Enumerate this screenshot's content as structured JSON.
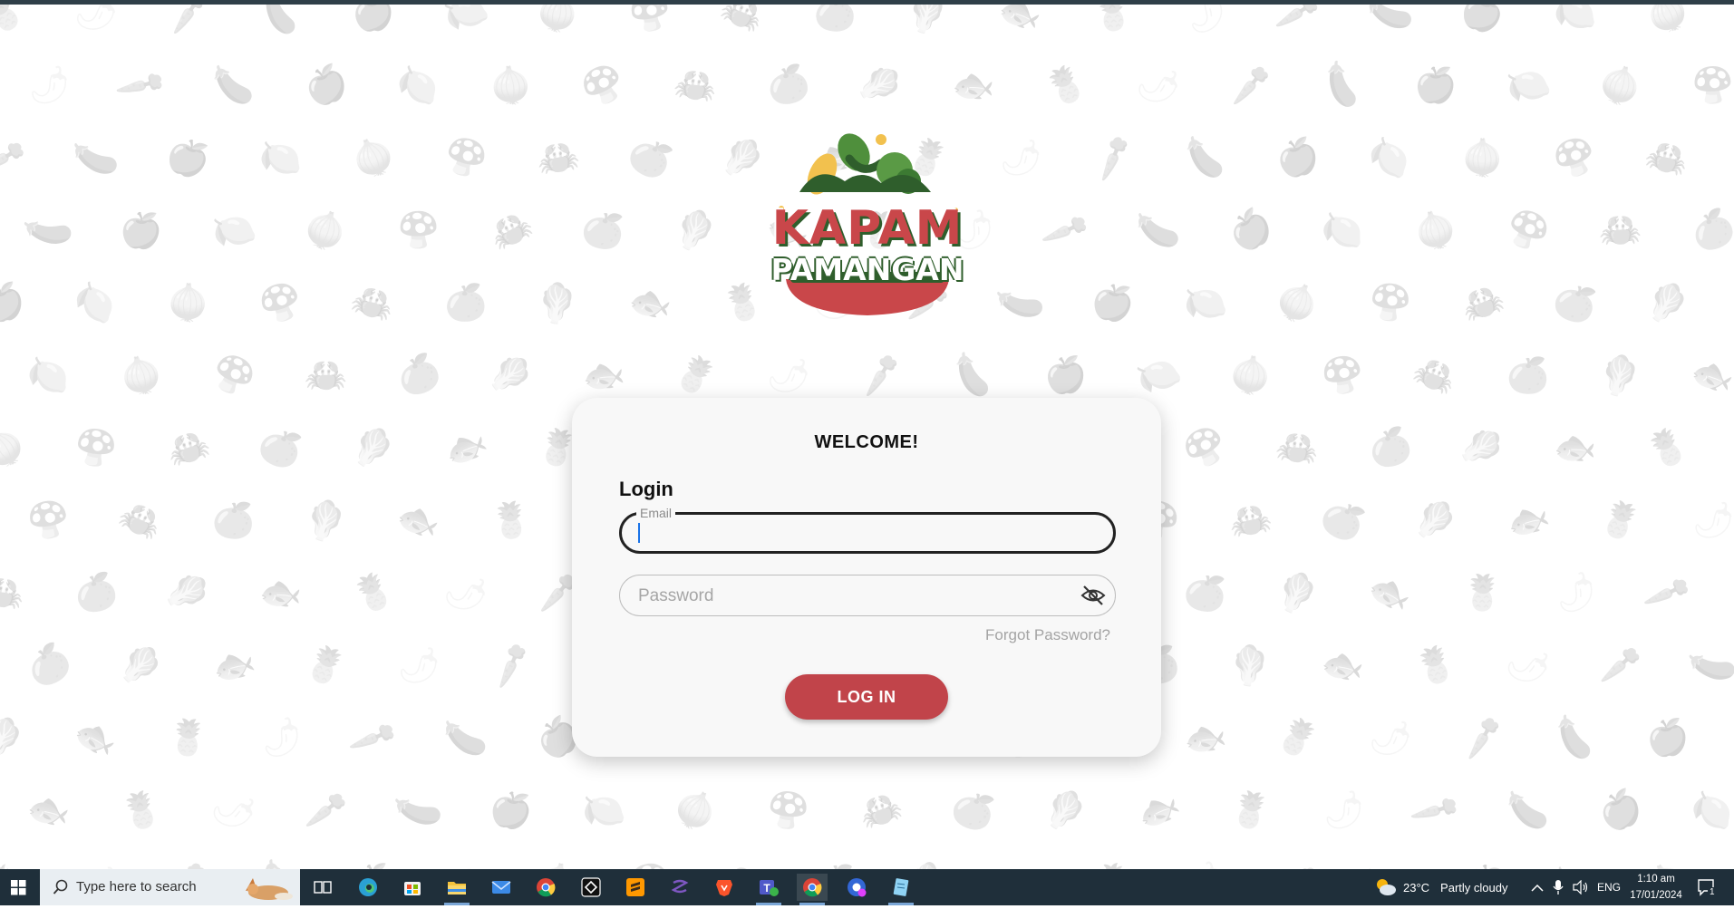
{
  "app": {
    "logo_line1": "KAPAM",
    "logo_line2": "PAMANGAN",
    "accent_color": "#c1444a",
    "logo_green": "#2f5e2c"
  },
  "login_card": {
    "heading": "WELCOME!",
    "section_title": "Login",
    "email": {
      "label": "Email",
      "value": ""
    },
    "password": {
      "placeholder": "Password",
      "value": "",
      "toggle_icon": "eye-slash-icon"
    },
    "forgot_link": "Forgot Password?",
    "submit_label": "LOG IN"
  },
  "taskbar": {
    "search_placeholder": "Type here to search",
    "apps": [
      {
        "name": "task-view-icon"
      },
      {
        "name": "edge-icon"
      },
      {
        "name": "microsoft-store-icon"
      },
      {
        "name": "file-explorer-icon"
      },
      {
        "name": "mail-icon"
      },
      {
        "name": "chrome-icon"
      },
      {
        "name": "capcut-icon"
      },
      {
        "name": "sublime-text-icon"
      },
      {
        "name": "visual-studio-icon"
      },
      {
        "name": "brave-icon"
      },
      {
        "name": "teams-icon"
      },
      {
        "name": "chrome-profile-icon"
      },
      {
        "name": "chrome-profile-2-icon"
      },
      {
        "name": "notepad-icon"
      }
    ],
    "weather": {
      "temperature": "23°C",
      "condition": "Partly cloudy"
    },
    "language": "ENG",
    "time": "1:10 am",
    "date": "17/01/2024",
    "notification_count": "1"
  }
}
